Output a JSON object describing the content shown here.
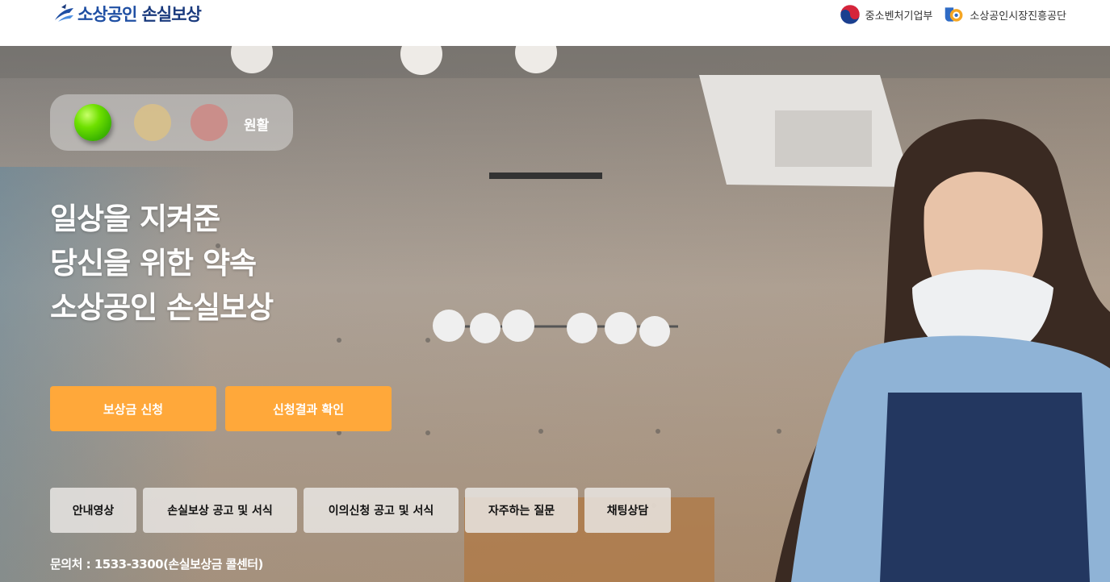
{
  "header": {
    "logo": {
      "text_main": "소상공인",
      "text_accent": "손실보상",
      "icon": "arrow-swoosh-icon"
    },
    "orgs": [
      {
        "label": "중소벤처기업부",
        "icon": "taegeuk-emblem-icon"
      },
      {
        "label": "소상공인시장진흥공단",
        "icon": "semas-emblem-icon"
      }
    ]
  },
  "status": {
    "label": "원활",
    "active_light": "green",
    "colors": {
      "green": "#5cd400",
      "yellow": "#d8c08a",
      "red": "#cc8a86"
    }
  },
  "headline": {
    "lines": [
      "일상을 지켜준",
      "당신을 위한 약속",
      "소상공인 손실보상"
    ]
  },
  "cta": {
    "apply": "보상금 신청",
    "result": "신청결과 확인",
    "color": "#ffa83a"
  },
  "quick_links": [
    {
      "label": "안내영상"
    },
    {
      "label": "손실보상 공고 및 서식"
    },
    {
      "label": "이의신청 공고 및 서식"
    },
    {
      "label": "자주하는 질문"
    },
    {
      "label": "채팅상담"
    }
  ],
  "contact": {
    "text": "문의처 : 1533-3300(손실보상금 콜센터)"
  }
}
